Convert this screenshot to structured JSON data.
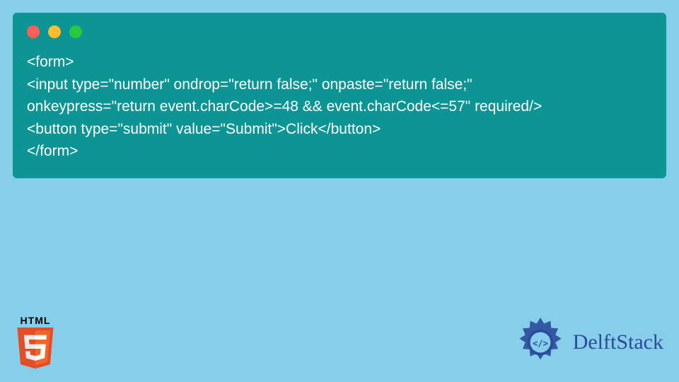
{
  "code": {
    "line1": "<form>",
    "line2": "<input type=\"number\" ondrop=\"return false;\" onpaste=\"return false;\"",
    "line3": "onkeypress=\"return event.charCode>=48 && event.charCode<=57\" required/>",
    "line4": "<button type=\"submit\" value=\"Submit\">Click</button>",
    "line5": "</form>"
  },
  "html5_label": "HTML",
  "brand": "DelftStack",
  "colors": {
    "background": "#87ceeb",
    "code_block": "#0d9494",
    "traffic_red": "#ff5f56",
    "traffic_yellow": "#ffbd2e",
    "traffic_green": "#27c93f",
    "html5_orange": "#e44d26",
    "html5_light": "#f16529",
    "delft_blue": "#2b4b9b"
  }
}
